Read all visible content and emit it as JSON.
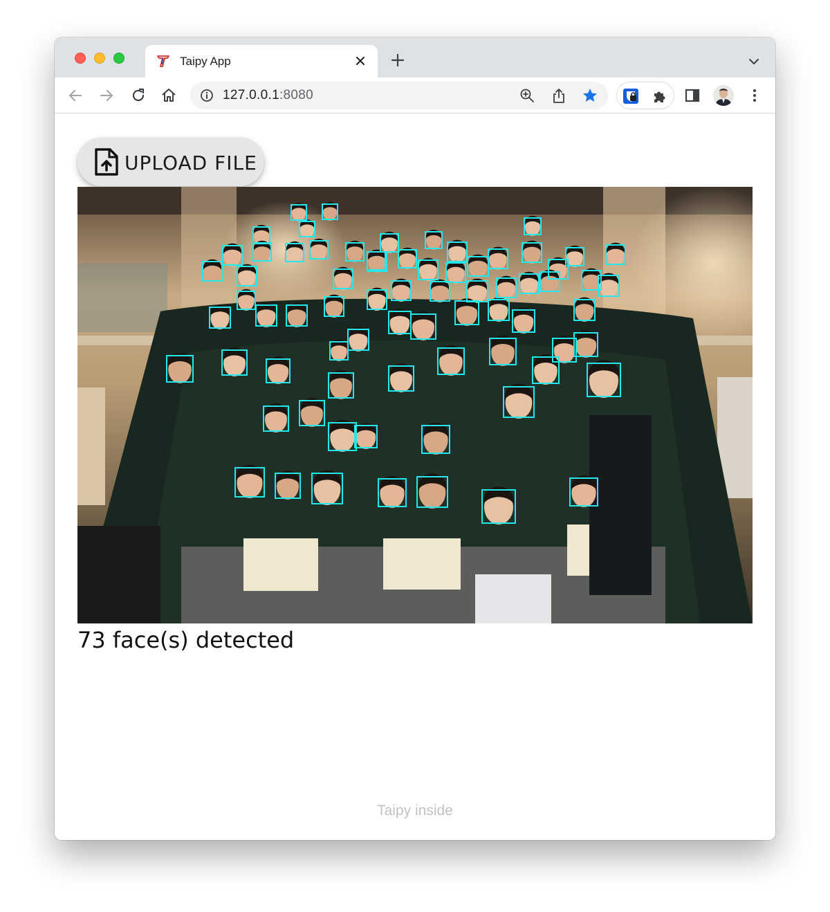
{
  "browser": {
    "tab_title": "Taipy App",
    "url_host": "127.0.0.1",
    "url_port": ":8080"
  },
  "app": {
    "upload_label": "UPLOAD FILE",
    "result_text": "73 face(s) detected",
    "footer_text": "Taipy inside"
  },
  "colors": {
    "face_box": "#25e7ee",
    "tab_bar": "#dee1e6",
    "star_accent": "#1a73e8",
    "favicon": "#d32f2f"
  },
  "icons": [
    "taipy-logo-icon",
    "close-icon",
    "plus-icon",
    "chevron-down-icon",
    "back-arrow-icon",
    "forward-arrow-icon",
    "reload-icon",
    "home-icon",
    "info-icon",
    "zoom-icon",
    "share-icon",
    "star-icon",
    "extension-bitwarden-icon",
    "puzzle-icon",
    "side-panel-icon",
    "more-vertical-icon",
    "file-upload-icon"
  ]
}
